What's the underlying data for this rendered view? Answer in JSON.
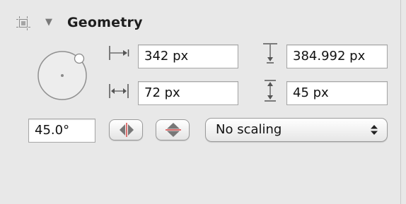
{
  "section": {
    "title": "Geometry",
    "disclosure_icon": "disclosure-triangle-down",
    "header_icon": "geometry-icon"
  },
  "position": {
    "x": {
      "icon": "x-position-icon",
      "value": "342 px"
    },
    "y": {
      "icon": "y-position-icon",
      "value": "384.992 px"
    }
  },
  "size": {
    "width": {
      "icon": "width-icon",
      "value": "72 px"
    },
    "height": {
      "icon": "height-icon",
      "value": "45 px"
    }
  },
  "rotation": {
    "dial_icon": "rotation-dial-icon",
    "value": "45.0°"
  },
  "flip": {
    "horizontal_icon": "flip-horizontal-icon",
    "vertical_icon": "flip-vertical-icon"
  },
  "scaling": {
    "selected": "No scaling",
    "arrow_icon": "select-arrows-icon"
  },
  "colors": {
    "panel_bg": "#e8e8e8",
    "field_border": "#a6a6a6",
    "flip_fill": "#777777",
    "flip_accent": "#d44545"
  }
}
